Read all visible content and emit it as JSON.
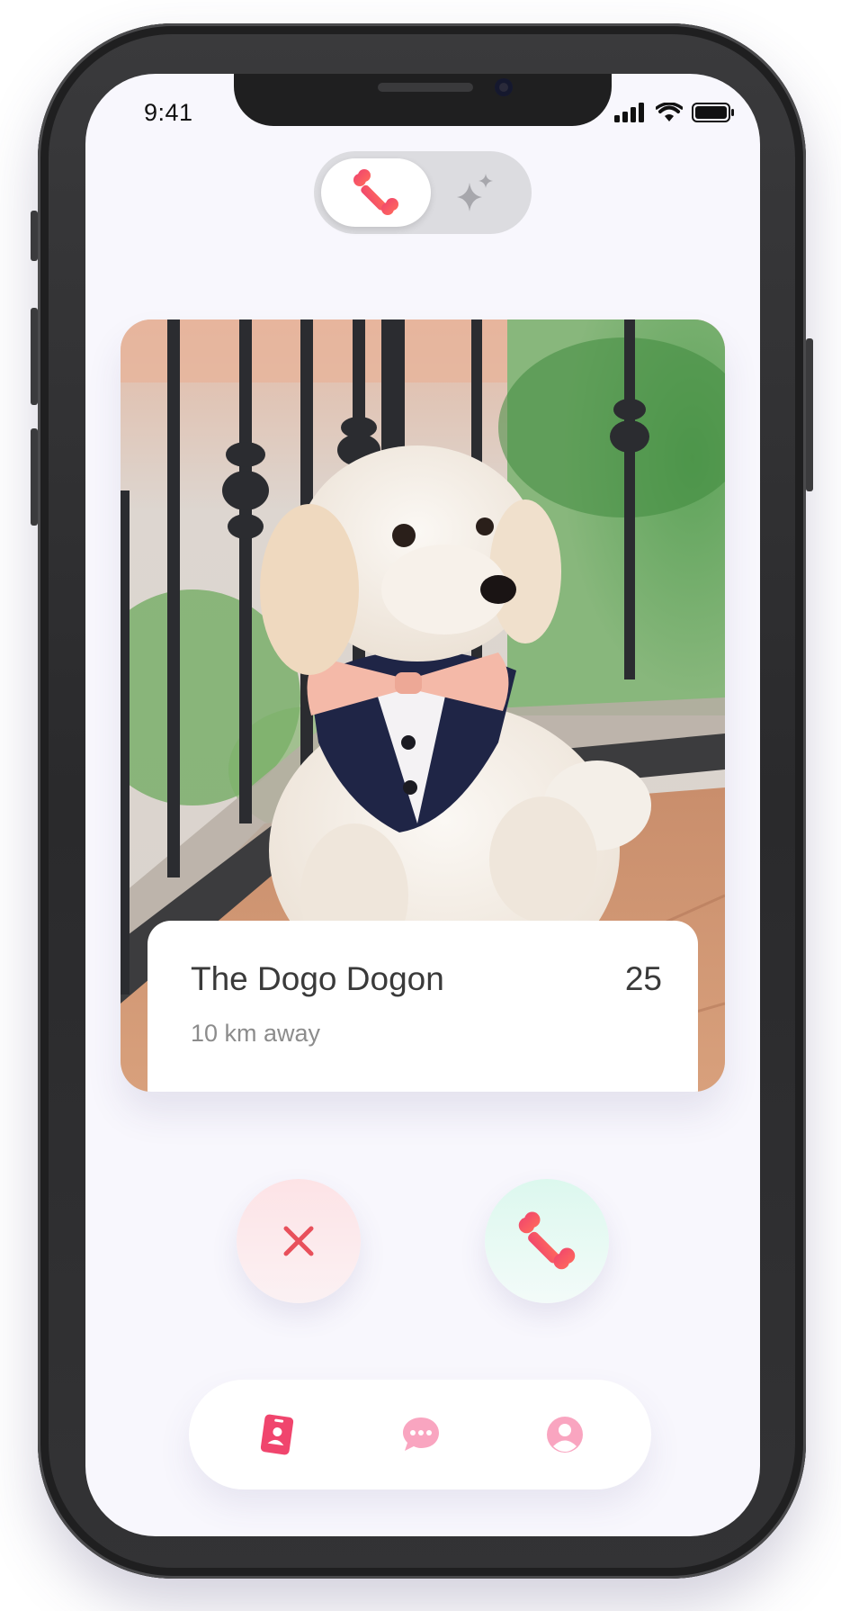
{
  "status_bar": {
    "time": "9:41"
  },
  "mode_toggle": {
    "active": "bone-icon",
    "inactive": "sparkles-icon"
  },
  "profile_card": {
    "name": "The Dogo Dogon",
    "age": "25",
    "distance": "10 km away"
  },
  "actions": {
    "nope_icon": "close-icon",
    "like_icon": "bone-icon"
  },
  "bottom_nav": {
    "items": [
      "profile-card-icon",
      "chat-icon",
      "user-icon"
    ],
    "active_index": 0
  },
  "colors": {
    "accent": "#f0456d",
    "accent_light": "#f9a5c0",
    "nope_red": "#e8505b",
    "screen_bg": "#f8f7fd"
  }
}
